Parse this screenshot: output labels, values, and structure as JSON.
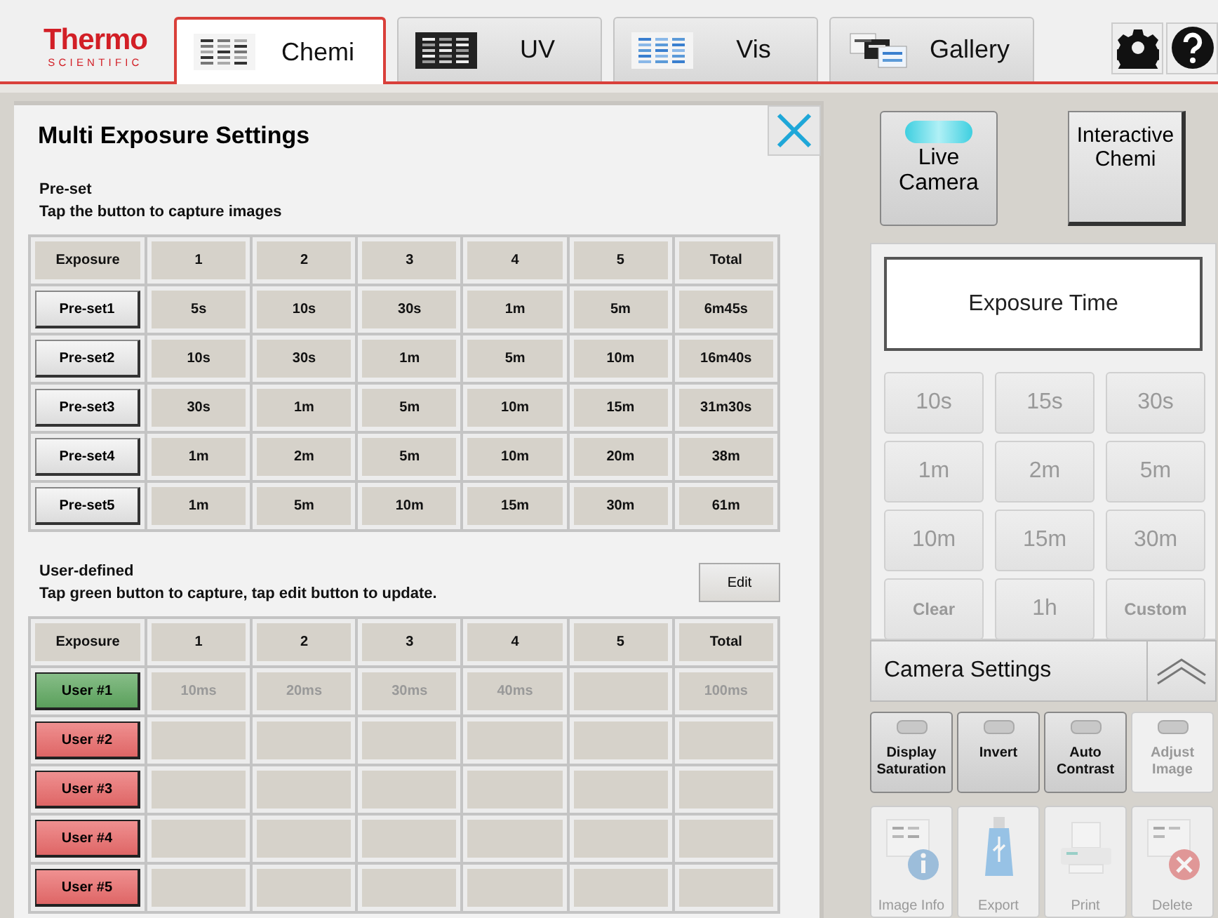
{
  "logo": {
    "brand": "Thermo",
    "sub": "SCIENTIFIC"
  },
  "tabs": [
    {
      "label": "Chemi",
      "kind": "chemi",
      "selected": true
    },
    {
      "label": "UV",
      "kind": "uv",
      "selected": false
    },
    {
      "label": "Vis",
      "kind": "vis",
      "selected": false
    },
    {
      "label": "Gallery",
      "kind": "gallery",
      "selected": false
    }
  ],
  "dialog": {
    "title": "Multi Exposure Settings",
    "preset": {
      "heading": "Pre-set",
      "hint": "Tap the button to capture images",
      "button_column": "Exposure",
      "columns": [
        "1",
        "2",
        "3",
        "4",
        "5",
        "Total"
      ],
      "rows": [
        {
          "button": "Pre-set1",
          "cells": [
            "5s",
            "10s",
            "30s",
            "1m",
            "5m",
            "6m45s"
          ]
        },
        {
          "button": "Pre-set2",
          "cells": [
            "10s",
            "30s",
            "1m",
            "5m",
            "10m",
            "16m40s"
          ]
        },
        {
          "button": "Pre-set3",
          "cells": [
            "30s",
            "1m",
            "5m",
            "10m",
            "15m",
            "31m30s"
          ]
        },
        {
          "button": "Pre-set4",
          "cells": [
            "1m",
            "2m",
            "5m",
            "10m",
            "20m",
            "38m"
          ]
        },
        {
          "button": "Pre-set5",
          "cells": [
            "1m",
            "5m",
            "10m",
            "15m",
            "30m",
            "61m"
          ]
        }
      ]
    },
    "user": {
      "heading": "User-defined",
      "hint": "Tap green button to capture, tap edit button to update.",
      "edit_button": "Edit",
      "button_column": "Exposure",
      "columns": [
        "1",
        "2",
        "3",
        "4",
        "5",
        "Total"
      ],
      "rows": [
        {
          "button": "User #1",
          "color": "#5fa860",
          "cells": [
            "10ms",
            "20ms",
            "30ms",
            "40ms",
            "",
            "100ms"
          ]
        },
        {
          "button": "User #2",
          "color": "#ea6b6b",
          "cells": [
            "",
            "",
            "",
            "",
            "",
            ""
          ]
        },
        {
          "button": "User #3",
          "color": "#ea6b6b",
          "cells": [
            "",
            "",
            "",
            "",
            "",
            ""
          ]
        },
        {
          "button": "User #4",
          "color": "#ea6b6b",
          "cells": [
            "",
            "",
            "",
            "",
            "",
            ""
          ]
        },
        {
          "button": "User #5",
          "color": "#ea6b6b",
          "cells": [
            "",
            "",
            "",
            "",
            "",
            ""
          ]
        }
      ]
    }
  },
  "live_camera": {
    "label": "Live Camera",
    "on": true
  },
  "interactive_button": "Interactive Chemi",
  "exposure_time": {
    "label": "Exposure Time",
    "presets": [
      {
        "label": "10s",
        "disabled": true
      },
      {
        "label": "15s",
        "disabled": true
      },
      {
        "label": "30s",
        "disabled": true
      },
      {
        "label": "1m",
        "disabled": true
      },
      {
        "label": "2m",
        "disabled": true
      },
      {
        "label": "5m",
        "disabled": true
      },
      {
        "label": "10m",
        "disabled": true
      },
      {
        "label": "15m",
        "disabled": true
      },
      {
        "label": "30m",
        "disabled": true
      },
      {
        "label": "Clear",
        "disabled": true
      },
      {
        "label": "1h",
        "disabled": true
      },
      {
        "label": "Custom",
        "disabled": true
      }
    ]
  },
  "camera_settings": {
    "label": "Camera Settings",
    "expanded": true
  },
  "toggles": [
    {
      "label": "Display Saturation",
      "on": false,
      "disabled": false
    },
    {
      "label": "Invert",
      "on": false,
      "disabled": false
    },
    {
      "label": "Auto Contrast",
      "on": false,
      "disabled": false
    },
    {
      "label": "Adjust Image",
      "on": false,
      "disabled": true
    }
  ],
  "actions": [
    {
      "label": "Image Info",
      "kind": "info",
      "disabled": true
    },
    {
      "label": "Export",
      "kind": "export",
      "disabled": true
    },
    {
      "label": "Print",
      "kind": "print",
      "disabled": true
    },
    {
      "label": "Delete",
      "kind": "delete",
      "disabled": true
    }
  ]
}
